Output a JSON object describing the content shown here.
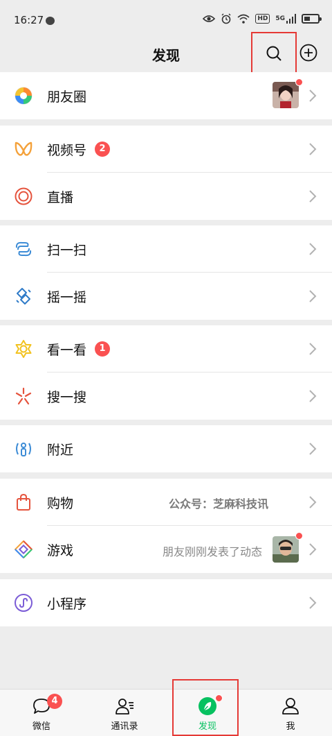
{
  "status": {
    "time": "16:27",
    "hd": "HD",
    "network": "5G"
  },
  "nav": {
    "title": "发现"
  },
  "items": [
    {
      "label": "朋友圈"
    },
    {
      "label": "视频号",
      "badge": "2"
    },
    {
      "label": "直播"
    },
    {
      "label": "扫一扫"
    },
    {
      "label": "摇一摇"
    },
    {
      "label": "看一看",
      "badge": "1"
    },
    {
      "label": "搜一搜"
    },
    {
      "label": "附近"
    },
    {
      "label": "购物",
      "sub": "公众号：芝麻科技讯"
    },
    {
      "label": "游戏",
      "sub": "朋友刚刚发表了动态"
    },
    {
      "label": "小程序"
    }
  ],
  "tabs": [
    {
      "label": "微信",
      "badge": "4"
    },
    {
      "label": "通讯录"
    },
    {
      "label": "发现"
    },
    {
      "label": "我"
    }
  ],
  "colors": {
    "accent": "#07c160",
    "badge": "#fa5151",
    "highlight": "#e53935"
  }
}
